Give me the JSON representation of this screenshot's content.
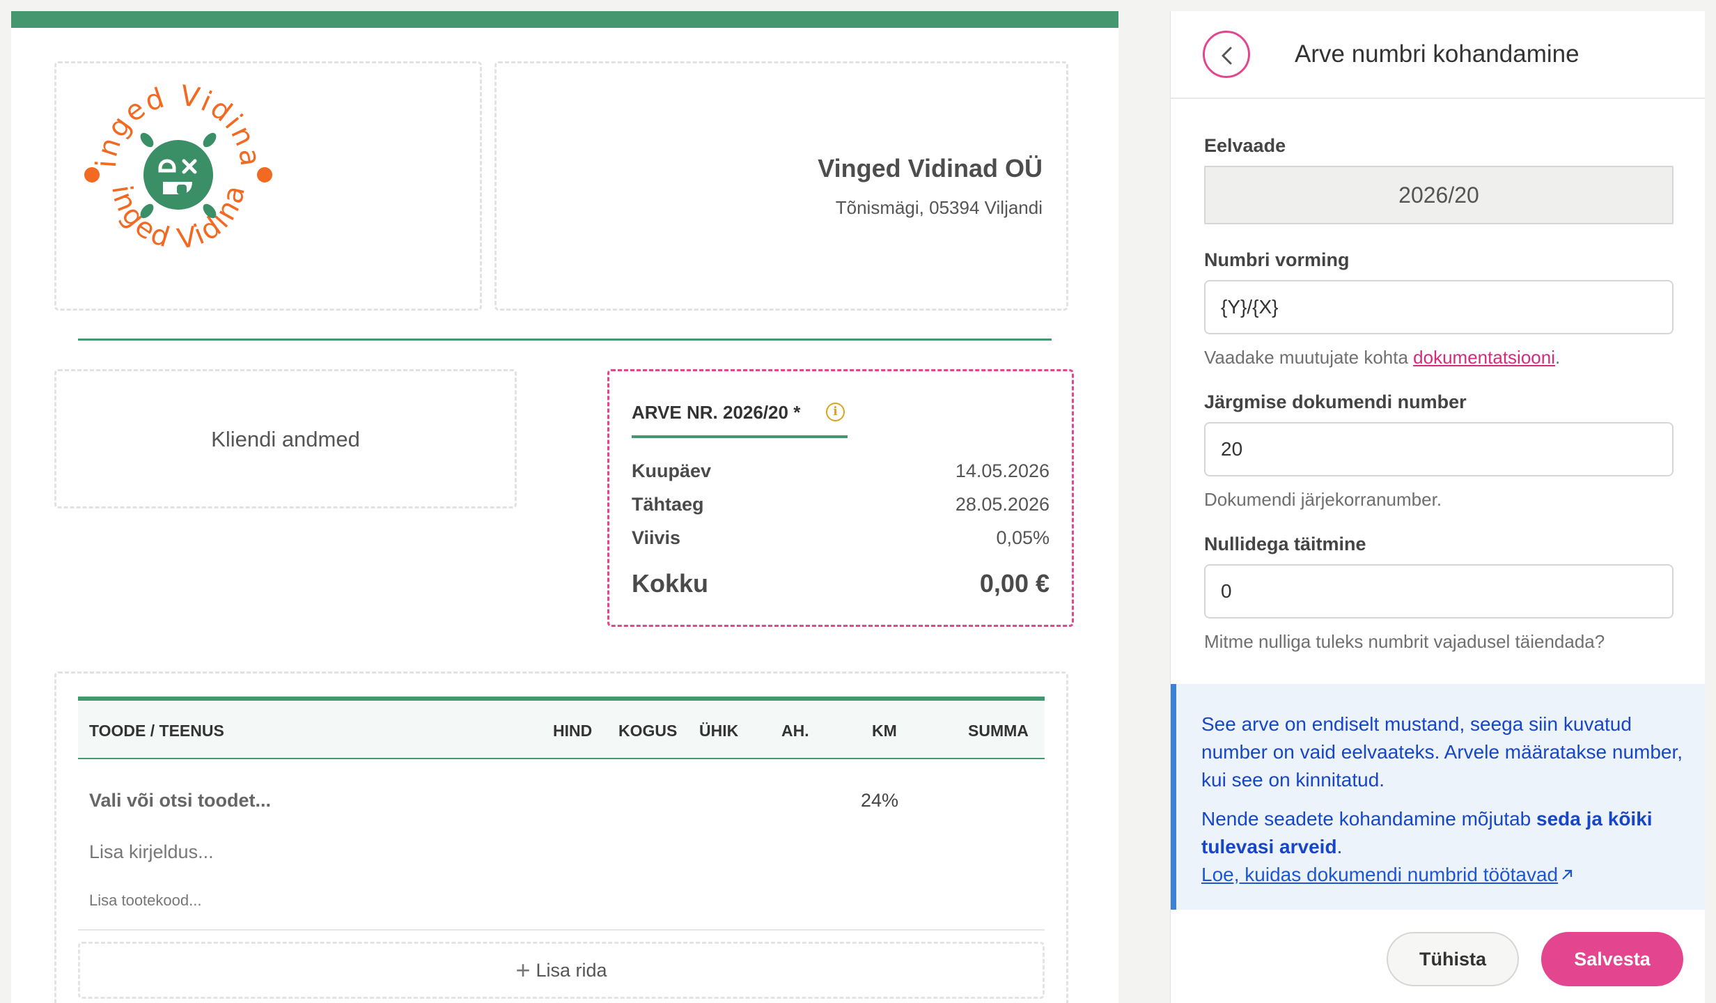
{
  "invoice": {
    "logo_text": "Vinged Vidinad",
    "company_name": "Vinged Vidinad OÜ",
    "company_address": "Tõnismägi, 05394 Viljandi",
    "client_placeholder": "Kliendi andmed",
    "meta": {
      "title": "ARVE NR. 2026/20 *",
      "rows": [
        {
          "label": "Kuupäev",
          "value": "14.05.2026"
        },
        {
          "label": "Tähtaeg",
          "value": "28.05.2026"
        },
        {
          "label": "Viivis",
          "value": "0,05%"
        }
      ],
      "total_label": "Kokku",
      "total_value": "0,00 €"
    },
    "table": {
      "headers": {
        "product": "TOODE / TEENUS",
        "price": "HIND",
        "qty": "KOGUS",
        "unit": "ÜHIK",
        "discount": "AH.",
        "vat": "KM",
        "sum": "SUMMA"
      },
      "row": {
        "product_placeholder": "Vali või otsi toodet...",
        "vat": "24%",
        "description_placeholder": "Lisa kirjeldus...",
        "code_placeholder": "Lisa tootekood..."
      },
      "add_row_label": "Lisa rida"
    }
  },
  "panel": {
    "title": "Arve numbri kohandamine",
    "preview_label": "Eelvaade",
    "preview_value": "2026/20",
    "format_label": "Numbri vorming",
    "format_value": "{Y}/{X}",
    "format_help_prefix": "Vaadake muutujate kohta ",
    "format_help_link": "dokumentatsiooni",
    "format_help_suffix": ".",
    "next_label": "Järgmise dokumendi number",
    "next_value": "20",
    "next_help": "Dokumendi järjekorranumber.",
    "padding_label": "Nullidega täitmine",
    "padding_value": "0",
    "padding_help": "Mitme nulliga tuleks numbrit vajadusel täiendada?",
    "info": {
      "p1": "See arve on endiselt mustand, seega siin kuvatud number on vaid eelvaateks. Arvele määratakse number, kui see on kinnitatud.",
      "p2_prefix": "Nende seadete kohandamine mõjutab ",
      "p2_bold": "seda ja kõiki tulevasi arveid",
      "p2_suffix": ".",
      "link": "Loe, kuidas dokumendi numbrid töötavad"
    },
    "cancel_label": "Tühista",
    "save_label": "Salvesta"
  },
  "colors": {
    "accent_green": "#44976f",
    "accent_pink": "#e3468f",
    "logo_orange": "#f26a21",
    "info_blue": "#1746c7"
  }
}
